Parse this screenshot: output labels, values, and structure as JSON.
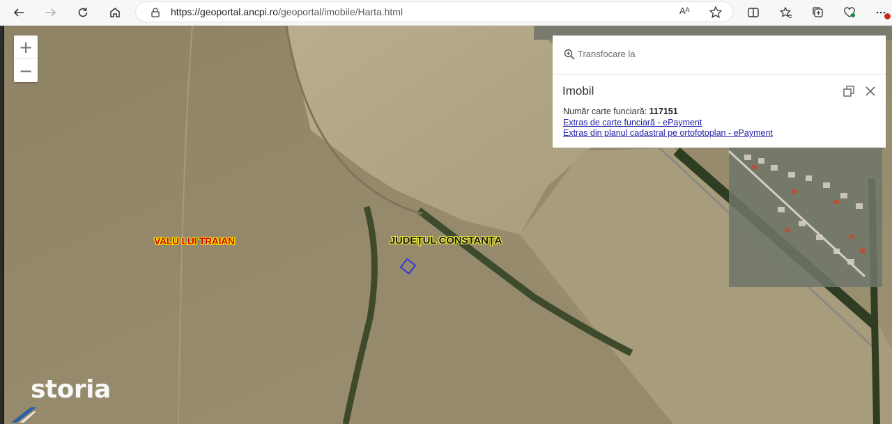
{
  "browser": {
    "url_host": "https://geoportal.ancpi.ro",
    "url_path": "/geoportal/imobile/Harta.html",
    "icons": [
      "back-icon",
      "forward-icon",
      "refresh-icon",
      "home-icon",
      "lock-icon",
      "read-aloud-icon",
      "favorite-star-icon",
      "split-screen-icon",
      "favorites-icon",
      "collections-icon",
      "browser-essentials-icon",
      "more-icon"
    ],
    "read_aloud_glyph": "Aᴬ"
  },
  "map": {
    "zoom_in": "+",
    "zoom_out": "−",
    "labels": {
      "valu": "VALU LUI TRAIAN",
      "judet": "JUDEȚUL CONSTANȚA"
    },
    "parcel_color": "#3636d8"
  },
  "popup": {
    "search_placeholder": "Transfocare la",
    "title": "Imobil",
    "cf_label": "Număr carte funciară:",
    "cf_value": "117151",
    "link1": "Extras de carte funciară - ePayment",
    "link2": "Extras din planul cadastral pe ortofotoplan - ePayment"
  },
  "watermark": {
    "text": "storia"
  }
}
